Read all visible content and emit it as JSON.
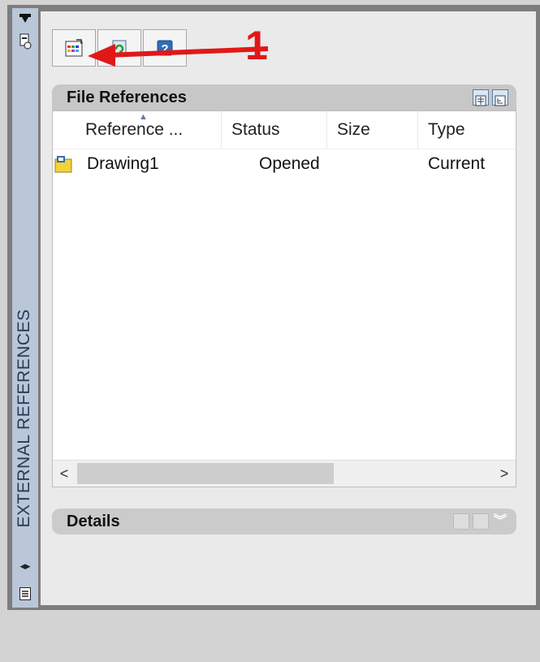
{
  "side_panel": {
    "title": "EXTERNAL REFERENCES",
    "resize_glyph": "◂▸"
  },
  "toolbar": {
    "buttons": [
      {
        "name": "attach-dwg-button",
        "icon": "attach-drawing-icon"
      },
      {
        "name": "refresh-button",
        "icon": "refresh-icon"
      },
      {
        "name": "help-button",
        "icon": "help-icon"
      }
    ]
  },
  "annotation": {
    "number": "1",
    "color": "#e01818"
  },
  "file_references": {
    "title": "File References",
    "columns": [
      "Reference ...",
      "Status",
      "Size",
      "Type"
    ],
    "rows": [
      {
        "name": "Drawing1",
        "status": "Opened",
        "size": "",
        "type": "Current"
      }
    ],
    "scroll": {
      "left": "<",
      "right": ">"
    }
  },
  "details": {
    "title": "Details"
  },
  "colors": {
    "side_strip": "#b9c7d9",
    "panel_bg": "#eaeaea",
    "header_bg": "#c7c7c7",
    "accent": "#5c7ca4"
  }
}
